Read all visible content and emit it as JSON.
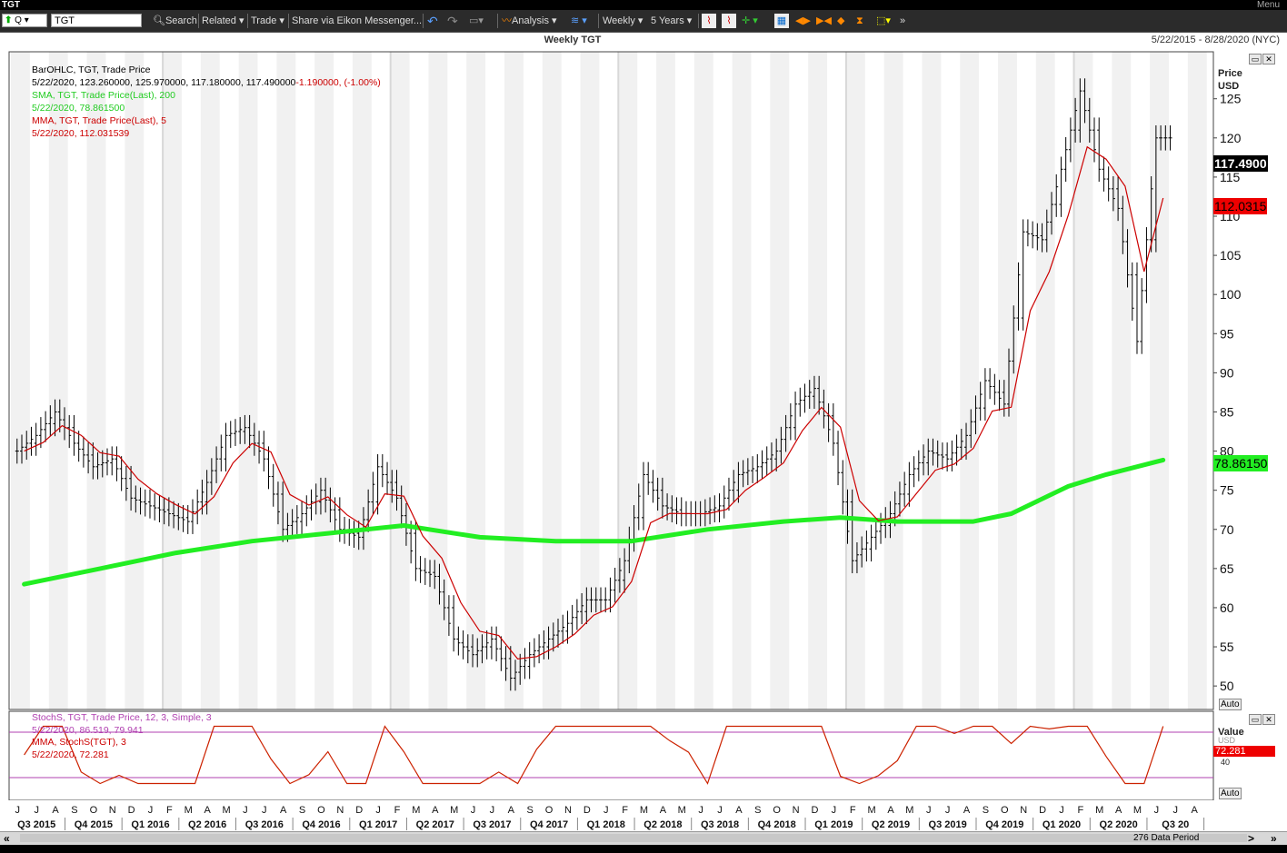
{
  "window": {
    "title": "TGT",
    "menu_label": "Menu"
  },
  "toolbar": {
    "ric_type": "Q",
    "ric_value": "TGT",
    "search_label": "Search",
    "related_label": "Related",
    "trade_label": "Trade",
    "share_label": "Share via Eikon Messenger...",
    "analysis_label": "Analysis",
    "interval_label": "Weekly",
    "range_label": "5 Years"
  },
  "header": {
    "title": "Weekly TGT",
    "date_range": "5/22/2015 - 8/28/2020 (NYC)"
  },
  "legend": {
    "ohlc_name": "BarOHLC, TGT, Trade Price",
    "ohlc_values": "5/22/2020, 123.260000, 125.970000, 117.180000, 117.490000",
    "ohlc_change": "-1.190000, (-1.00%)",
    "sma_name": "SMA, TGT, Trade Price(Last),  200",
    "sma_value": "5/22/2020, 78.861500",
    "mma_name": "MMA, TGT, Trade Price(Last),  5",
    "mma_value": "5/22/2020, 112.031539",
    "stoch_name": "StochS, TGT, Trade Price,  12, 3, Simple, 3",
    "stoch_value": "5/22/2020, 86.519, 79.941",
    "stoch_mma_name": "MMA, StochS(TGT),  3",
    "stoch_mma_value": "5/22/2020, 72.281"
  },
  "axis": {
    "price_title": "Price",
    "price_unit": "USD",
    "value_title": "Value",
    "value_unit": "USD",
    "auto_label": "Auto",
    "last_price_badge": "117.4900",
    "mma_badge": "112.0315",
    "sma_badge": "78.86150",
    "stoch_badge": "72.281",
    "stoch_tick": "40",
    "months": [
      "J",
      "J",
      "A",
      "S",
      "O",
      "N",
      "D",
      "J",
      "F",
      "M",
      "A",
      "M",
      "J",
      "J",
      "A",
      "S",
      "O",
      "N",
      "D",
      "J",
      "F",
      "M",
      "A",
      "M",
      "J",
      "J",
      "A",
      "S",
      "O",
      "N",
      "D",
      "J",
      "F",
      "M",
      "A",
      "M",
      "J",
      "J",
      "A",
      "S",
      "O",
      "N",
      "D",
      "J",
      "F",
      "M",
      "A",
      "M",
      "J",
      "J",
      "A",
      "S",
      "O",
      "N",
      "D",
      "J",
      "F",
      "M",
      "A",
      "M",
      "J",
      "J",
      "A"
    ],
    "quarters": [
      "Q3 2015",
      "Q4 2015",
      "Q1 2016",
      "Q2 2016",
      "Q3 2016",
      "Q4 2016",
      "Q1 2017",
      "Q2 2017",
      "Q3 2017",
      "Q4 2017",
      "Q1 2018",
      "Q2 2018",
      "Q3 2018",
      "Q4 2018",
      "Q1 2019",
      "Q2 2019",
      "Q3 2019",
      "Q4 2019",
      "Q1 2020",
      "Q2 2020",
      "Q3 20"
    ]
  },
  "footer": {
    "data_period": "276 Data Period"
  },
  "colors": {
    "price_bar": "#000000",
    "sma": "#22ee22",
    "mma": "#cc0000",
    "stoch": "#cc44cc",
    "stoch_mma": "#cc2200",
    "band": "#f1f1f1"
  },
  "chart_data": {
    "type": "line",
    "ylim": [
      47,
      131
    ],
    "yticks": [
      50,
      55,
      60,
      65,
      70,
      75,
      80,
      85,
      90,
      95,
      100,
      105,
      110,
      115,
      120,
      125
    ],
    "last_close": 117.49,
    "series": [
      {
        "name": "TGT",
        "x": [
          "2015-05",
          "2015-06",
          "2015-07",
          "2015-08",
          "2015-09",
          "2015-10",
          "2015-11",
          "2015-12",
          "2016-01",
          "2016-02",
          "2016-03",
          "2016-04",
          "2016-05",
          "2016-06",
          "2016-07",
          "2016-08",
          "2016-09",
          "2016-10",
          "2016-11",
          "2016-12",
          "2017-01",
          "2017-02",
          "2017-03",
          "2017-04",
          "2017-05",
          "2017-06",
          "2017-07",
          "2017-08",
          "2017-09",
          "2017-10",
          "2017-11",
          "2017-12",
          "2018-01",
          "2018-02",
          "2018-03",
          "2018-04",
          "2018-05",
          "2018-06",
          "2018-07",
          "2018-08",
          "2018-09",
          "2018-10",
          "2018-11",
          "2018-12",
          "2019-01",
          "2019-02",
          "2019-03",
          "2019-04",
          "2019-05",
          "2019-06",
          "2019-07",
          "2019-08",
          "2019-09",
          "2019-10",
          "2019-11",
          "2019-12",
          "2020-01",
          "2020-02",
          "2020-03",
          "2020-04",
          "2020-05"
        ],
        "values": [
          80,
          82,
          85,
          81,
          78,
          79,
          74,
          73,
          72,
          71,
          76,
          82,
          83,
          79,
          70,
          72,
          75,
          70,
          69,
          78,
          74,
          65,
          64,
          56,
          54,
          56,
          51,
          54,
          56,
          58,
          61,
          61,
          66,
          77,
          73,
          72,
          72,
          73,
          77,
          78,
          80,
          86,
          88,
          81,
          66,
          69,
          72,
          77,
          80,
          79,
          82,
          89,
          86,
          108,
          107,
          116,
          126,
          116,
          111,
          94,
          120
        ]
      },
      {
        "name": "SMA 200",
        "x": [
          "2015-05",
          "2015-09",
          "2016-01",
          "2016-05",
          "2016-09",
          "2017-01",
          "2017-05",
          "2017-09",
          "2018-01",
          "2018-05",
          "2018-09",
          "2018-12",
          "2019-03",
          "2019-07",
          "2019-09",
          "2019-12",
          "2020-02",
          "2020-05"
        ],
        "values": [
          63,
          65,
          67,
          68.5,
          69.5,
          70.5,
          69,
          68.5,
          68.5,
          70,
          71,
          71.5,
          71,
          71,
          72,
          75.5,
          77,
          78.8615
        ]
      }
    ]
  }
}
